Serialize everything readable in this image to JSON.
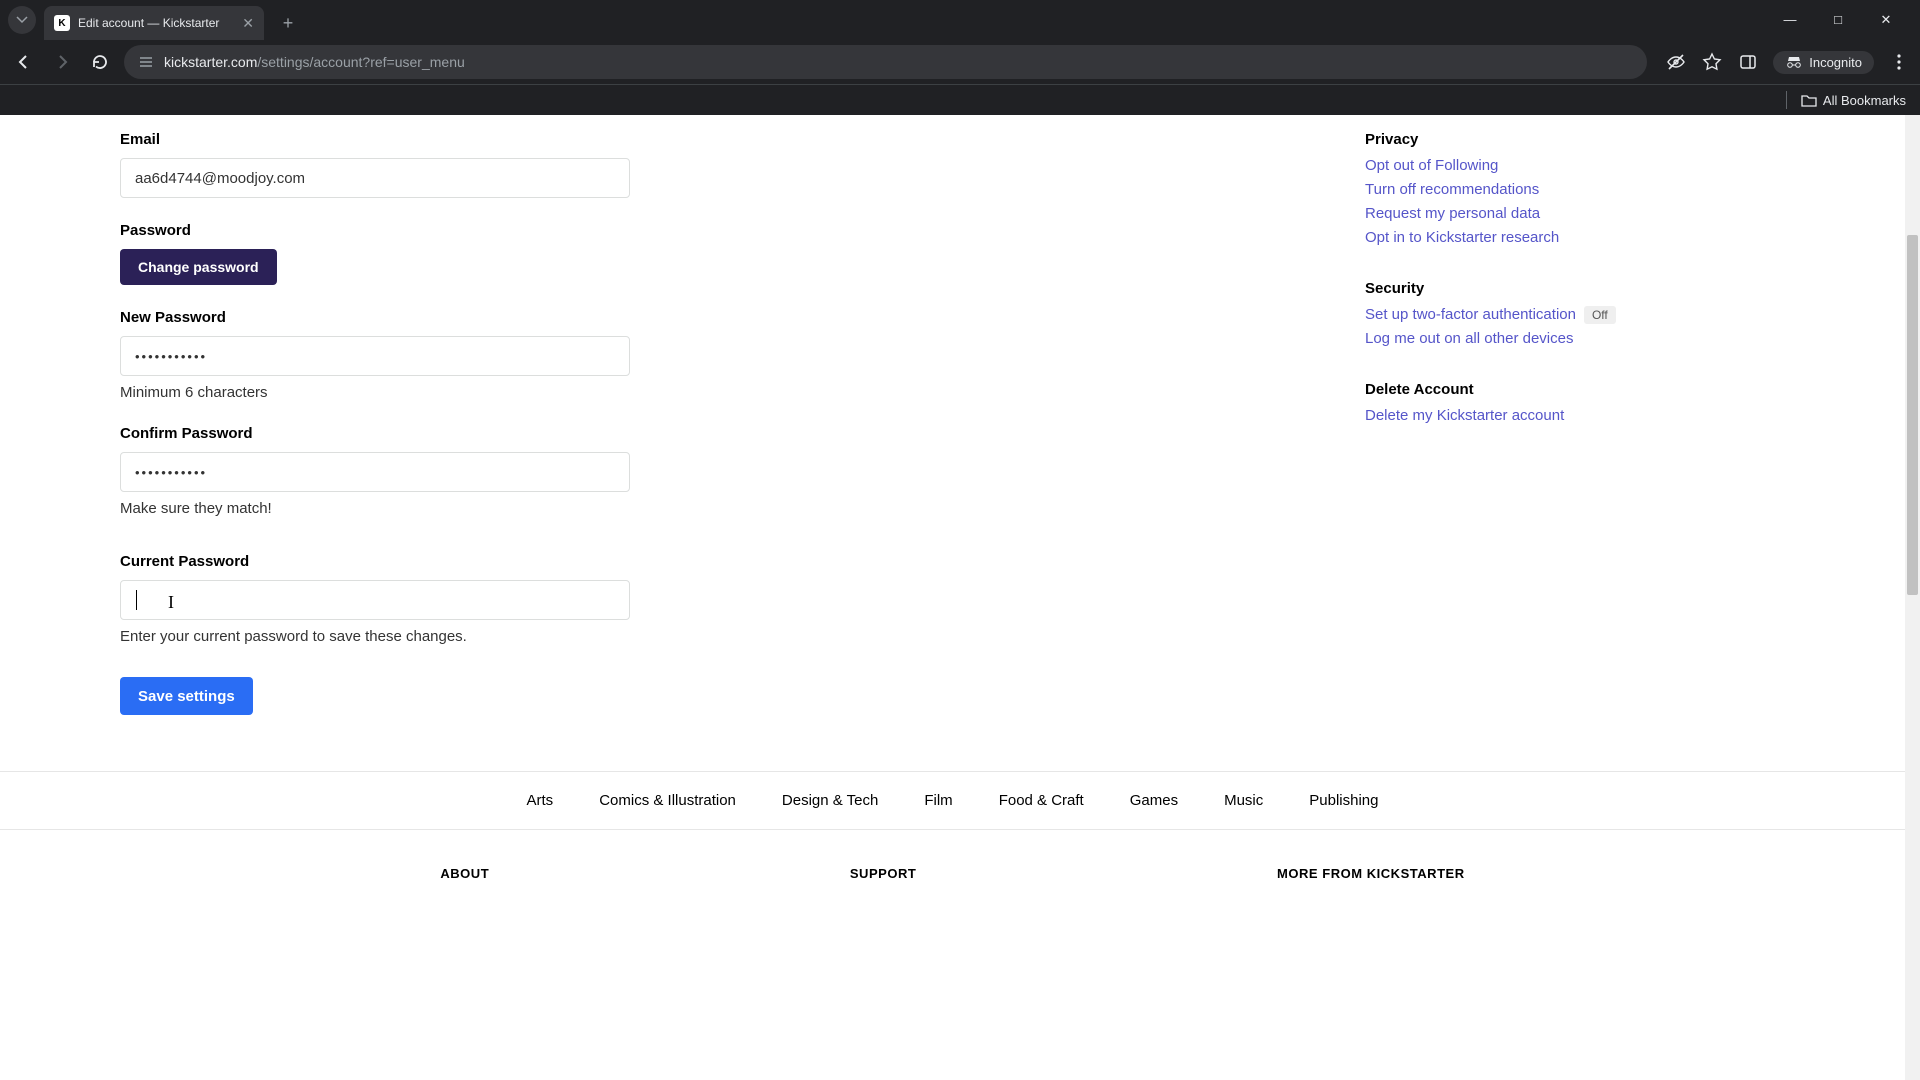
{
  "browser": {
    "tab_title": "Edit account — Kickstarter",
    "url_host": "kickstarter.com",
    "url_path": "/settings/account?ref=user_menu",
    "incognito_label": "Incognito",
    "all_bookmarks": "All Bookmarks"
  },
  "form": {
    "email_label": "Email",
    "email_value": "aa6d4744@moodjoy.com",
    "password_label": "Password",
    "change_password_btn": "Change password",
    "new_password_label": "New Password",
    "new_password_value": "•••••••••••",
    "new_password_helper": "Minimum 6 characters",
    "confirm_password_label": "Confirm Password",
    "confirm_password_value": "•••••••••••",
    "confirm_password_helper": "Make sure they match!",
    "current_password_label": "Current Password",
    "current_password_value": "",
    "current_password_helper": "Enter your current password to save these changes.",
    "save_btn": "Save settings"
  },
  "sidebar": {
    "privacy": {
      "heading": "Privacy",
      "links": [
        "Opt out of Following",
        "Turn off recommendations",
        "Request my personal data",
        "Opt in to Kickstarter research"
      ]
    },
    "security": {
      "heading": "Security",
      "twofa_link": "Set up two-factor authentication",
      "twofa_badge": "Off",
      "logout_link": "Log me out on all other devices"
    },
    "delete": {
      "heading": "Delete Account",
      "link": "Delete my Kickstarter account"
    }
  },
  "footer_nav": [
    "Arts",
    "Comics & Illustration",
    "Design & Tech",
    "Film",
    "Food & Craft",
    "Games",
    "Music",
    "Publishing"
  ],
  "footer_cols": [
    "ABOUT",
    "SUPPORT",
    "MORE FROM KICKSTARTER"
  ]
}
